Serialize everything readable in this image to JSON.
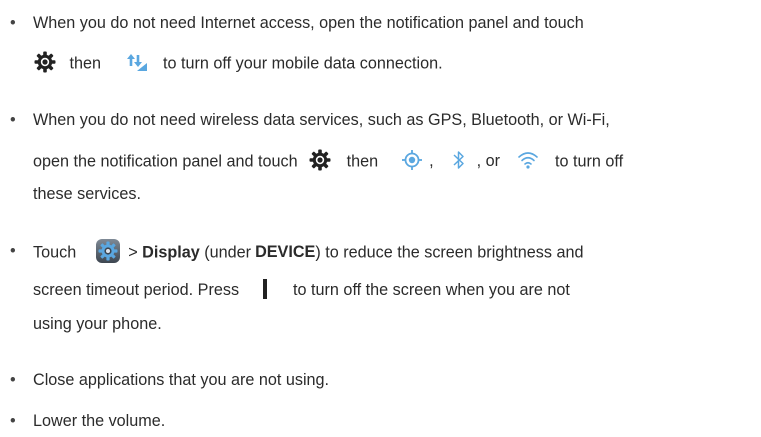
{
  "bullet_char": "•",
  "items": [
    {
      "line1": {
        "text": "When you do not need Internet access, open the notification panel and touch"
      },
      "line2": {
        "t1": "then",
        "t2": "to turn off your mobile data connection."
      },
      "icons": [
        "settings-gear-icon",
        "mobile-data-icon"
      ]
    },
    {
      "line1": {
        "text": "When you do not need wireless data services, such as GPS, Bluetooth, or Wi-Fi,"
      },
      "line2": {
        "t1": "open the notification panel and touch",
        "t2": "then",
        "t3": ",",
        "t4": ", or",
        "t5": "to turn off"
      },
      "line3": {
        "text": "these services."
      },
      "icons": [
        "settings-gear-icon",
        "gps-location-icon",
        "bluetooth-icon",
        "wifi-icon"
      ]
    },
    {
      "line1": {
        "t1": "Touch",
        "t2": ">",
        "bold1": "Display",
        "t3": "(under",
        "bold2": "DEVICE",
        "t4": ") to reduce the screen brightness and"
      },
      "line2": {
        "t1": "screen timeout period. Press",
        "t2": "to turn off the screen when you are not"
      },
      "line3": {
        "text": "using your phone."
      },
      "icons": [
        "settings-app-icon",
        "power-button-icon"
      ]
    },
    {
      "line1": {
        "text": "Close applications that you are not using."
      }
    },
    {
      "line1": {
        "text": "Lower the volume."
      }
    }
  ],
  "colors": {
    "text": "#2b2b2b",
    "accent": "#5aa7e0",
    "icon_dark": "#222222"
  }
}
